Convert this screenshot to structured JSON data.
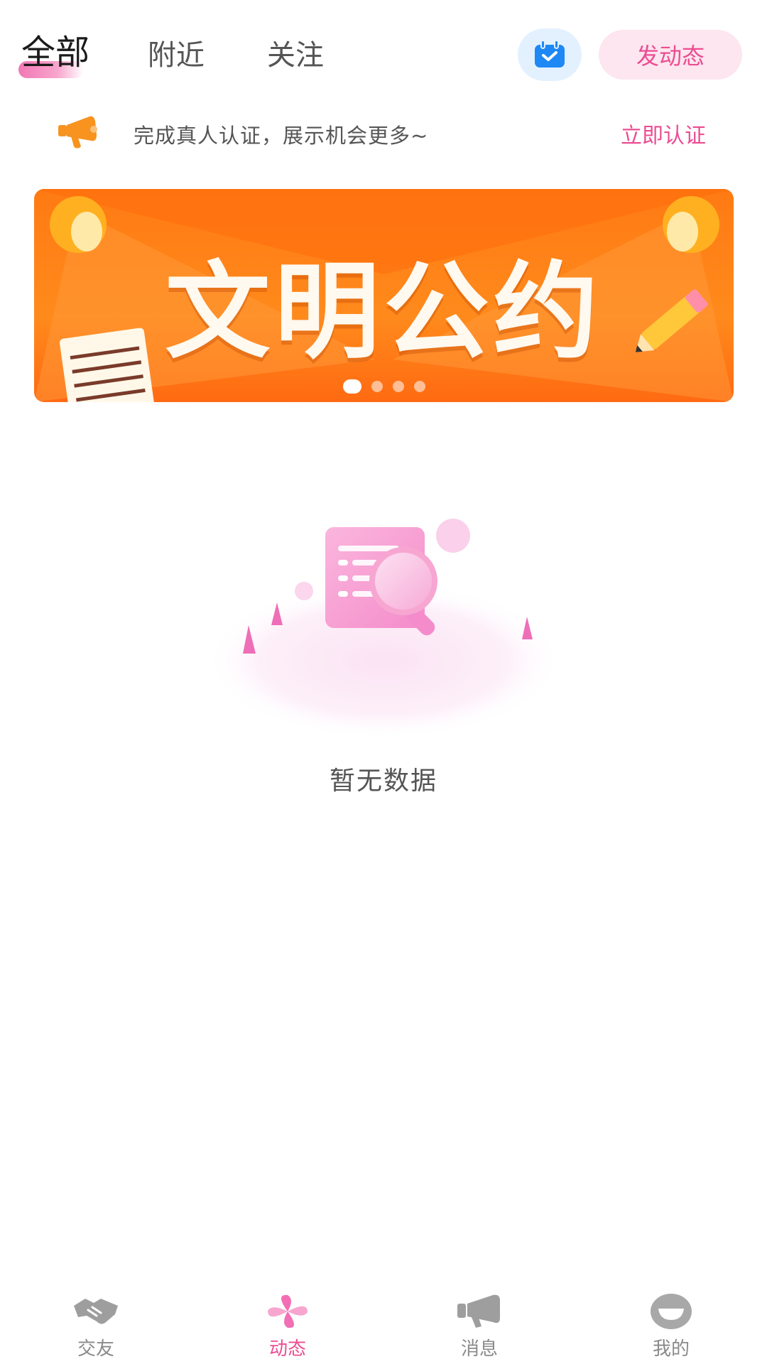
{
  "tabs": [
    {
      "label": "全部",
      "active": true
    },
    {
      "label": "附近",
      "active": false
    },
    {
      "label": "关注",
      "active": false
    }
  ],
  "header": {
    "checkin_icon": "calendar-check-icon",
    "post_label": "发动态"
  },
  "notice": {
    "icon": "megaphone-icon",
    "text": "完成真人认证，展示机会更多~",
    "action_label": "立即认证"
  },
  "banner": {
    "title": "文明公约",
    "slide_count": 4,
    "active_index": 0
  },
  "empty_state": {
    "icon": "empty-search-illustration",
    "message": "暂无数据"
  },
  "bottom_nav": [
    {
      "label": "交友",
      "icon": "handshake-icon",
      "active": false
    },
    {
      "label": "动态",
      "icon": "pinwheel-icon",
      "active": true
    },
    {
      "label": "消息",
      "icon": "megaphone-icon",
      "active": false
    },
    {
      "label": "我的",
      "icon": "smile-face-icon",
      "active": false
    }
  ],
  "colors": {
    "accent_pink": "#ec4d93",
    "banner_orange": "#ff7a13",
    "checkin_blue": "#1e88f5",
    "inactive_gray": "#8a8a8a"
  }
}
